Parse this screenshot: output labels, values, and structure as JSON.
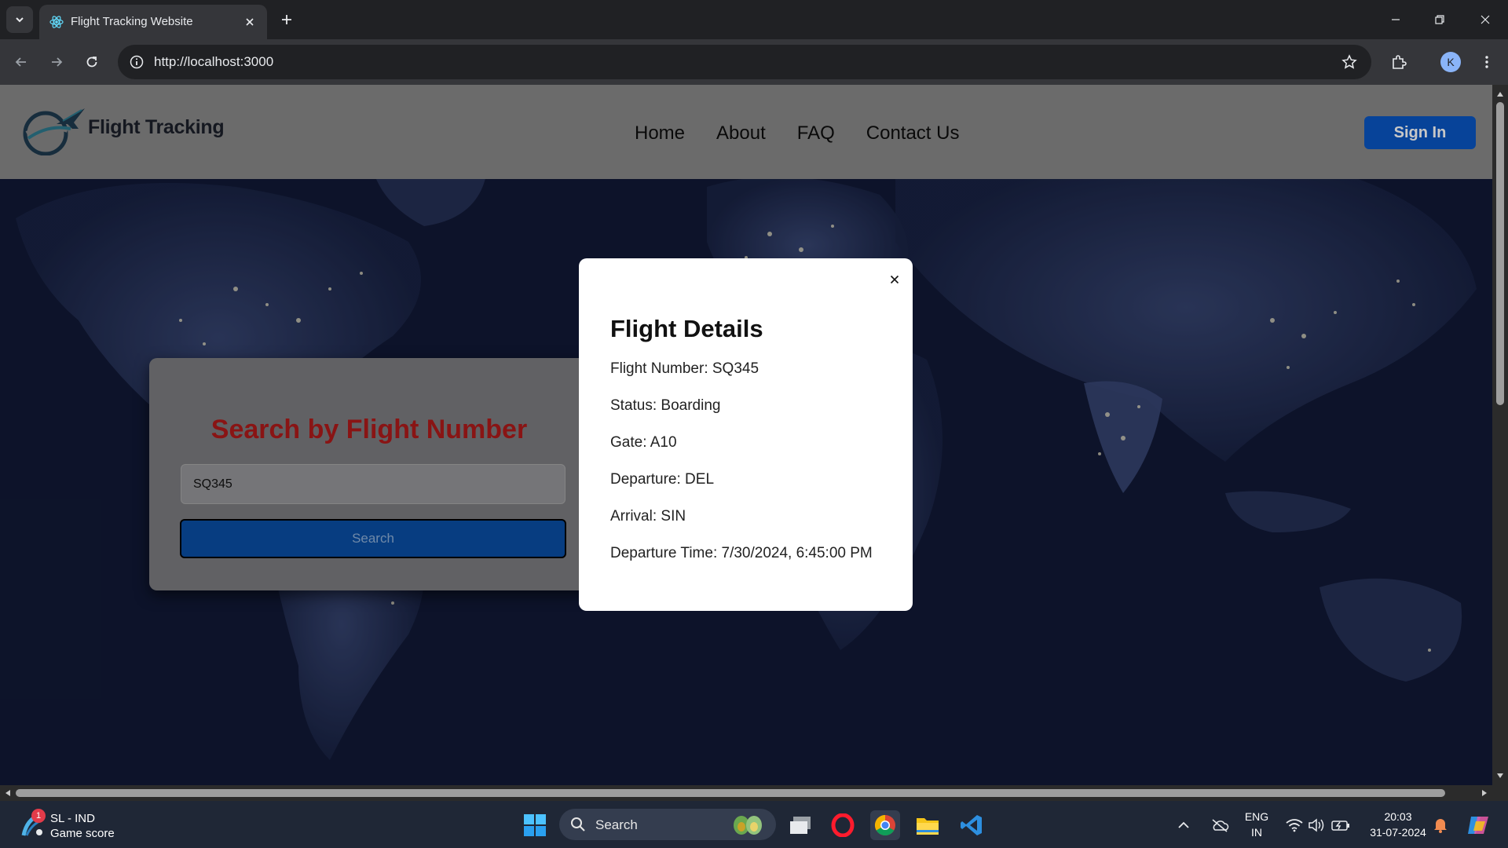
{
  "browser": {
    "tab_title": "Flight Tracking Website",
    "url": "http://localhost:3000",
    "profile_initial": "K"
  },
  "site": {
    "brand": "Flight Tracking",
    "nav": [
      "Home",
      "About",
      "FAQ",
      "Contact Us"
    ],
    "sign_in": "Sign In"
  },
  "search": {
    "title": "Search by Flight Number",
    "input_value": "SQ345",
    "button_label": "Search"
  },
  "modal": {
    "title": "Flight Details",
    "close_symbol": "×",
    "details": [
      "Flight Number: SQ345",
      "Status: Boarding",
      "Gate: A10",
      "Departure: DEL",
      "Arrival: SIN",
      "Departure Time: 7/30/2024, 6:45:00 PM"
    ]
  },
  "taskbar": {
    "widget_badge": "1",
    "widget_line1": "SL - IND",
    "widget_line2": "Game score",
    "search_label": "Search",
    "language": "ENG",
    "region": "IN",
    "time": "20:03",
    "date": "31-07-2024"
  },
  "colors": {
    "header_bg": "#8a8a8a",
    "sign_in_bg": "#0a57c4",
    "search_title": "#b01a1a",
    "search_button": "#0a4fa6",
    "map_bg": "#121a36"
  }
}
